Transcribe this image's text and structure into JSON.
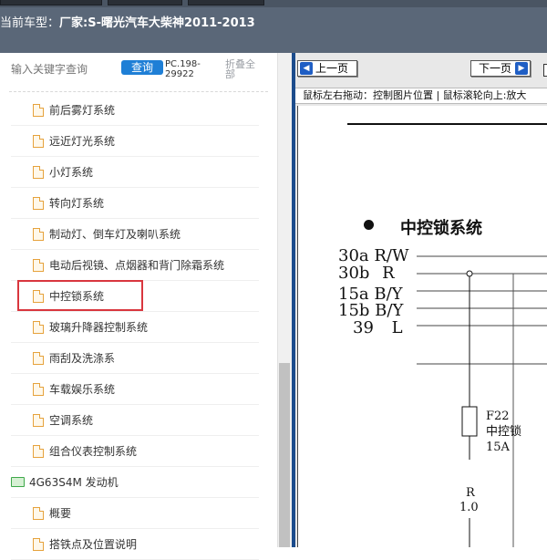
{
  "header": {
    "vehicle_label": "当前车型：",
    "vehicle_value": "厂家:S-曙光汽车大柴神2011-2013"
  },
  "sidebar": {
    "search_placeholder": "输入关键字查询",
    "query_button": "查询",
    "pc_code": "PC.198-29922",
    "collapse_all": "折叠全部",
    "items": [
      {
        "label": "前后雾灯系统",
        "type": "doc"
      },
      {
        "label": "远近灯光系统",
        "type": "doc"
      },
      {
        "label": "小灯系统",
        "type": "doc"
      },
      {
        "label": "转向灯系统",
        "type": "doc"
      },
      {
        "label": "制动灯、倒车灯及喇叭系统",
        "type": "doc"
      },
      {
        "label": "电动后视镜、点烟器和背门除霜系统",
        "type": "doc"
      },
      {
        "label": "中控锁系统",
        "type": "doc",
        "selected": true
      },
      {
        "label": "玻璃升降器控制系统",
        "type": "doc"
      },
      {
        "label": "雨刮及洗涤系",
        "type": "doc"
      },
      {
        "label": "车载娱乐系统",
        "type": "doc"
      },
      {
        "label": "空调系统",
        "type": "doc"
      },
      {
        "label": "组合仪表控制系统",
        "type": "doc"
      },
      {
        "label": "4G63S4M 发动机",
        "type": "folder"
      },
      {
        "label": "概要",
        "type": "doc"
      },
      {
        "label": "搭铁点及位置说明",
        "type": "doc"
      }
    ]
  },
  "viewer": {
    "prev_button": "上一页",
    "next_button": "下一页",
    "hint": "鼠标左右拖动：控制图片位置 | 鼠标滚轮向上:放大",
    "diagram": {
      "title": "中控锁系统",
      "pins": [
        {
          "pin": "30a",
          "color": "R/W"
        },
        {
          "pin": "30b",
          "color": "R"
        },
        {
          "pin": "15a",
          "color": "B/Y"
        },
        {
          "pin": "15b",
          "color": "B/Y"
        },
        {
          "pin": "39",
          "color": "L"
        }
      ],
      "fuse": {
        "id": "F22",
        "name": "中控锁",
        "rating": "15A"
      },
      "wire": {
        "color": "R",
        "size": "1.0"
      }
    }
  },
  "colors": {
    "header_bg": "#5a6778",
    "query_button": "#1f7fd6",
    "highlight": "#d9363e",
    "viewer_border": "#1c4c8c"
  }
}
